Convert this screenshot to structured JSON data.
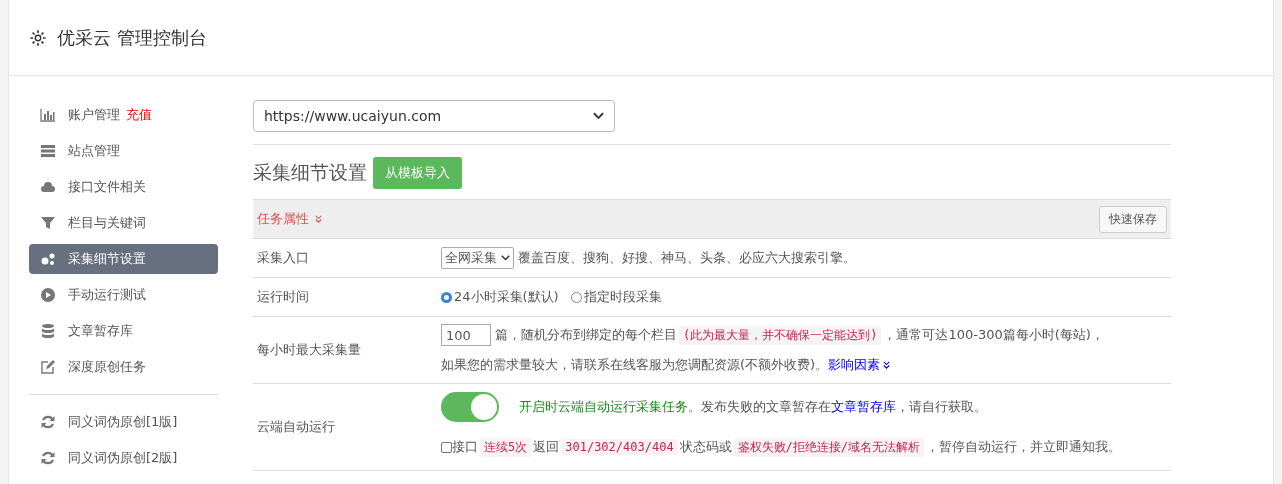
{
  "header": {
    "title": "优采云 管理控制台"
  },
  "sidebar": {
    "groups": [
      {
        "items": [
          {
            "label": "账户管理",
            "badge": "充值",
            "selected": false
          },
          {
            "label": "站点管理",
            "selected": false
          },
          {
            "label": "接口文件相关",
            "selected": false
          },
          {
            "label": "栏目与关键词",
            "selected": false
          },
          {
            "label": "采集细节设置",
            "selected": true
          },
          {
            "label": "手动运行测试",
            "selected": false
          },
          {
            "label": "文章暂存库",
            "selected": false
          },
          {
            "label": "深度原创任务",
            "selected": false
          }
        ]
      },
      {
        "items": [
          {
            "label": "同义词伪原创[1版]",
            "selected": false
          },
          {
            "label": "同义词伪原创[2版]",
            "selected": false
          }
        ]
      }
    ]
  },
  "site_select": {
    "value": "https://www.ucaiyun.com"
  },
  "section": {
    "title": "采集细节设置",
    "import_button": "从模板导入"
  },
  "panel": {
    "heading": "任务属性",
    "save_button": "快速保存",
    "rows": [
      {
        "kind": "source",
        "label": "采集入口",
        "select": "全网采集",
        "text": "覆盖百度、搜狗、好搜、神马、头条、必应六大搜索引擎。"
      },
      {
        "kind": "radios",
        "label": "运行时间",
        "options": [
          {
            "label": "24小时采集(默认)",
            "selected": true
          },
          {
            "label": "指定时段采集",
            "selected": false
          }
        ]
      },
      {
        "kind": "amount",
        "label": "每小时最大采集量",
        "value": "100",
        "lines": [
          [
            {
              "kind": "text",
              "text": "篇，随机分布到绑定的每个栏目"
            },
            {
              "kind": "code",
              "text": "(此为最大量，并不确保一定能达到)"
            },
            {
              "kind": "text",
              "text": "，通常可达100-300篇每小时(每站)，"
            }
          ],
          [
            {
              "kind": "text",
              "text": "如果您的需求量较大，请联系在线客服为您调配资源(不额外收费)。"
            },
            {
              "kind": "more",
              "text": "影响因素"
            }
          ]
        ]
      },
      {
        "kind": "auto",
        "label": "云端自动运行",
        "on": true,
        "checked": false,
        "lines": [
          [
            {
              "kind": "green",
              "text": "开启时云端自动运行采集任务。"
            },
            {
              "kind": "text",
              "text": "发布失败的文章暂存在"
            },
            {
              "kind": "link",
              "text": "文章暂存库"
            },
            {
              "kind": "text",
              "text": "，请自行获取。"
            }
          ],
          [
            {
              "kind": "text",
              "text": "接口"
            },
            {
              "kind": "code",
              "text": "连续5次"
            },
            {
              "kind": "text",
              "text": "返回"
            },
            {
              "kind": "code",
              "text": "301/302/403/404"
            },
            {
              "kind": "text",
              "text": "状态码或"
            },
            {
              "kind": "code",
              "text": "鉴权失败/拒绝连接/域名无法解析"
            },
            {
              "kind": "text",
              "text": "，暂停自动运行，并立即通知我。"
            }
          ]
        ]
      }
    ]
  }
}
